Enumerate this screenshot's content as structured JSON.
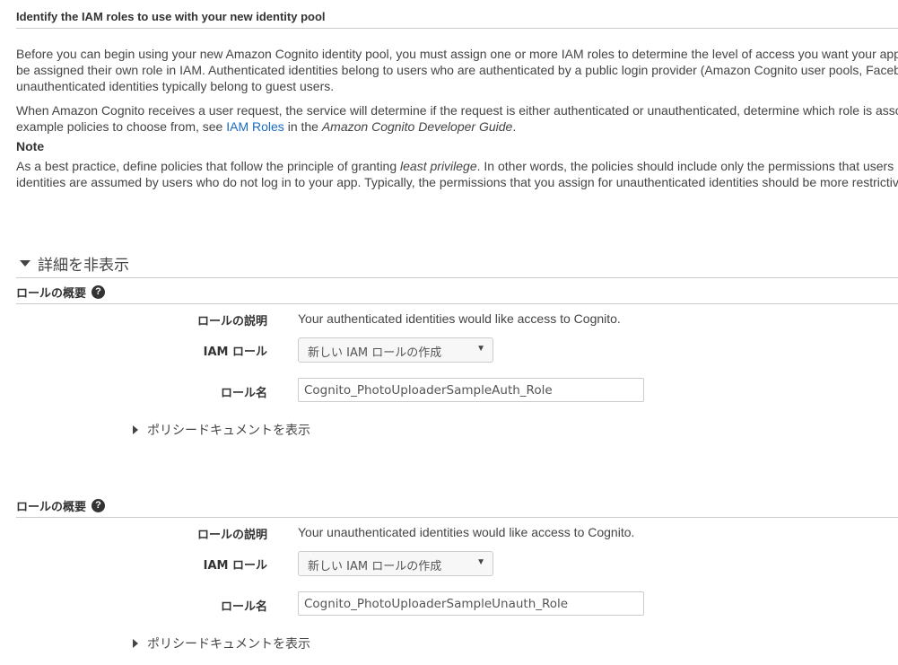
{
  "header": {
    "title": "Identify the IAM roles to use with your new identity pool"
  },
  "intro": {
    "p1_line1": "Before you can begin using your new Amazon Cognito identity pool, you must assign one or more IAM roles to determine the level of access you want your app",
    "p1_line2": "be assigned their own role in IAM. Authenticated identities belong to users who are authenticated by a public login provider (Amazon Cognito user pools, Facebo",
    "p1_line3": "unauthenticated identities typically belong to guest users.",
    "p2_line1": "When Amazon Cognito receives a user request, the service will determine if the request is either authenticated or unauthenticated, determine which role is asso",
    "p2_pre_link": "example policies to choose from, see ",
    "p2_link": "IAM Roles",
    "p2_mid": " in the ",
    "p2_guide": "Amazon Cognito Developer Guide",
    "p2_end": "."
  },
  "note": {
    "heading": "Note",
    "line1_pre": "As a best practice, define policies that follow the principle of granting ",
    "line1_em": "least privilege",
    "line1_post": ". In other words, the policies should include only the permissions that users r",
    "line2": "identities are assumed by users who do not log in to your app. Typically, the permissions that you assign for unauthenticated identities should be more restrictive"
  },
  "details_toggle": {
    "label": "詳細を非表示"
  },
  "roles": [
    {
      "header": "ロールの概要",
      "desc_label": "ロールの説明",
      "desc_value": "Your authenticated identities would like access to Cognito.",
      "iam_label": "IAM ロール",
      "iam_selected": "新しい IAM ロールの作成",
      "name_label": "ロール名",
      "name_value": "Cognito_PhotoUploaderSampleAuth_Role",
      "policy_toggle": "ポリシードキュメントを表示"
    },
    {
      "header": "ロールの概要",
      "desc_label": "ロールの説明",
      "desc_value": "Your unauthenticated identities would like access to Cognito.",
      "iam_label": "IAM ロール",
      "iam_selected": "新しい IAM ロールの作成",
      "name_label": "ロール名",
      "name_value": "Cognito_PhotoUploaderSampleUnauth_Role",
      "policy_toggle": "ポリシードキュメントを表示"
    }
  ],
  "icons": {
    "help": "help-circle-icon",
    "expanded": "caret-down-icon",
    "collapsed": "caret-right-icon",
    "select": "dropdown-arrow-icon"
  },
  "colors": {
    "link": "#1a6ac3",
    "divider": "#cccccc"
  }
}
